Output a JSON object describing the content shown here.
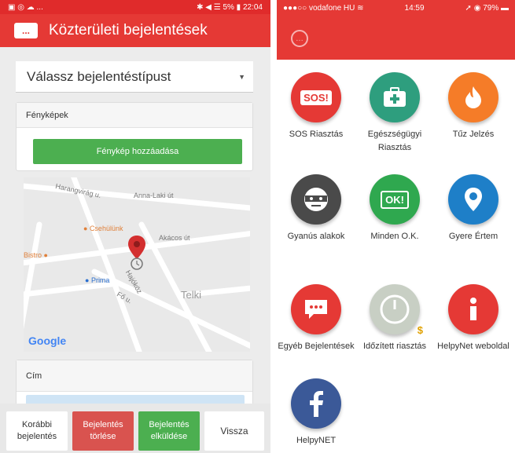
{
  "left": {
    "status_time": "22:04",
    "status_battery": "5%",
    "header_title": "Közterületi bejelentések",
    "chat_glyph": "...",
    "select_value": "Válassz bejelentéstípust",
    "photos": {
      "title": "Fényképek",
      "add_button": "Fénykép hozzáadása"
    },
    "map": {
      "streets": [
        "Harangvirág u.",
        "Anna-Laki út",
        "Akácos út",
        "Hajóköz",
        "Fő u."
      ],
      "places": [
        "Csehülünk",
        "Bistro",
        "Prima",
        "Telki"
      ],
      "logo": "Google"
    },
    "address_title": "Cím",
    "buttons": {
      "previous": "Korábbi bejelentés",
      "delete": "Bejelentés törlése",
      "send": "Bejelentés elküldése",
      "back": "Vissza"
    }
  },
  "right": {
    "status_carrier": "●●●○○ vodafone HU",
    "status_time": "14:59",
    "status_battery": "79%",
    "tiles": [
      {
        "label": "SOS Riasztás",
        "color": "#e53935",
        "icon": "sos-icon",
        "glyph": "SOS!"
      },
      {
        "label": "Egészségügyi Riasztás",
        "color": "#2e9e7e",
        "icon": "medkit-icon"
      },
      {
        "label": "Tűz Jelzés",
        "color": "#f57c28",
        "icon": "fire-icon"
      },
      {
        "label": "Gyanús alakok",
        "color": "#4a4a4a",
        "icon": "burglar-icon"
      },
      {
        "label": "Minden O.K.",
        "color": "#2fa84f",
        "icon": "ok-icon",
        "glyph": "OK!"
      },
      {
        "label": "Gyere Értem",
        "color": "#1e7fc8",
        "icon": "location-pin-icon"
      },
      {
        "label": "Egyéb Bejelentések",
        "color": "#e53935",
        "icon": "chat-bubble-icon"
      },
      {
        "label": "Időzített riasztás",
        "color": "#c8cfc4",
        "icon": "timer-icon"
      },
      {
        "label": "HelpyNet weboldal",
        "color": "#e53935",
        "icon": "info-icon"
      },
      {
        "label": "HelpyNET",
        "color": "#3b5998",
        "icon": "facebook-icon"
      }
    ]
  }
}
